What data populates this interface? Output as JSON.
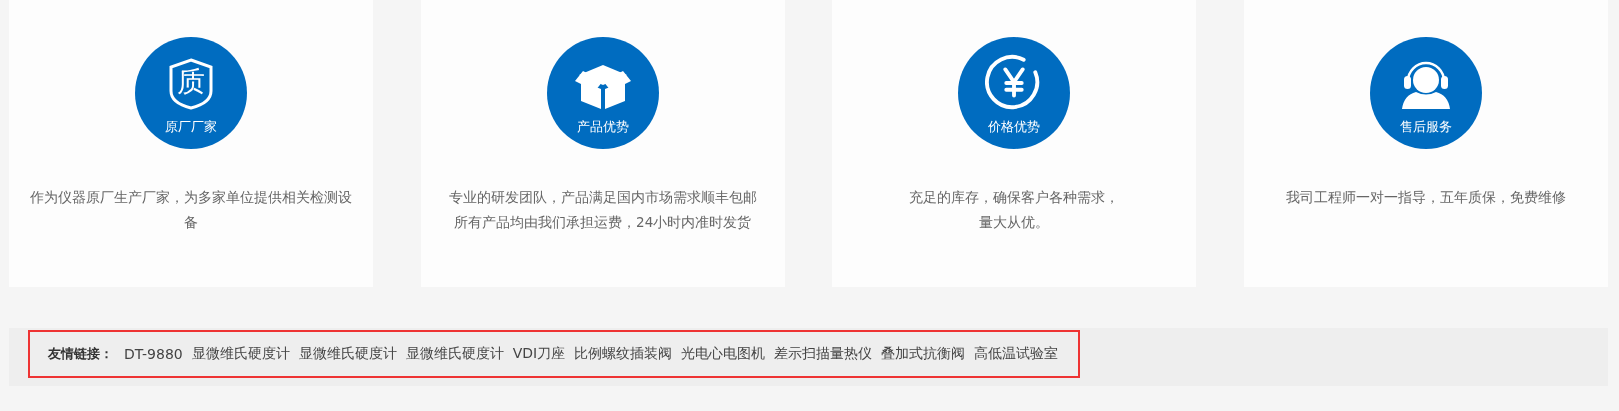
{
  "features": [
    {
      "icon_text": "质",
      "title": "原厂厂家",
      "description_lines": [
        "作为仪器原厂生产厂家，为多家单位提供相关检测设",
        "备"
      ]
    },
    {
      "title": "产品优势",
      "description_lines": [
        "专业的研发团队，产品满足国内市场需求顺丰包邮",
        "所有产品均由我们承担运费，24小时内准时发货"
      ]
    },
    {
      "title": "价格优势",
      "description_lines": [
        "充足的库存，确保客户各种需求，",
        "量大从优。"
      ]
    },
    {
      "title": "售后服务",
      "description_lines": [
        "我司工程师一对一指导，五年质保，免费维修"
      ]
    }
  ],
  "friend_links": {
    "label": "友情链接：",
    "highlighted": true,
    "links": [
      "DT-9880",
      "显微维氏硬度计",
      "显微维氏硬度计",
      "显微维氏硬度计",
      "VDI刀座",
      "比例螺纹插装阀",
      "光电心电图机",
      "差示扫描量热仪",
      "叠加式抗衡阀",
      "高低温试验室"
    ]
  }
}
